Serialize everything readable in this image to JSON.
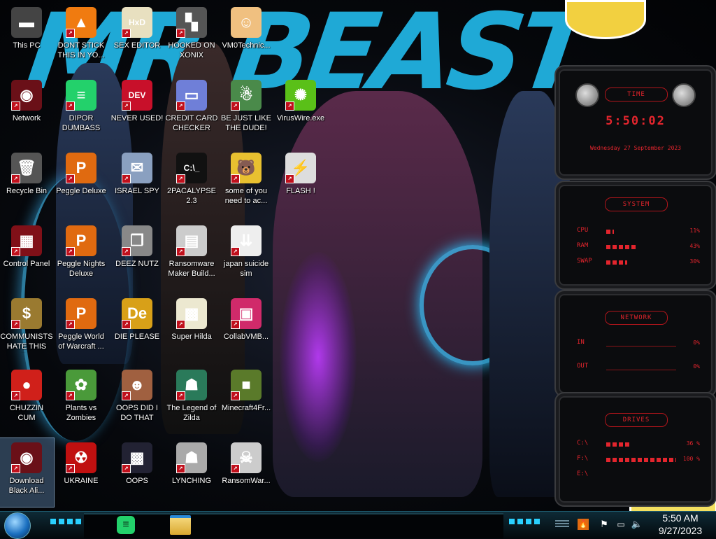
{
  "desktop": {
    "icons": [
      {
        "label": "This PC",
        "glyph": "▬",
        "color": "#444"
      },
      {
        "label": "DONT STICK THIS IN YO...",
        "glyph": "▲",
        "color": "#f07b10"
      },
      {
        "label": "SEX EDITOR",
        "glyph": "HxD",
        "color": "#e8e0c0"
      },
      {
        "label": "HOOKED ON XONIX",
        "glyph": "▚",
        "color": "#555"
      },
      {
        "label": "VM0Technic...",
        "glyph": "☺",
        "color": "#f0c080"
      },
      {
        "label": "Network",
        "glyph": "◉",
        "color": "#6a1018"
      },
      {
        "label": "DIPOR DUMBASS",
        "glyph": "≡",
        "color": "#23d16b"
      },
      {
        "label": "NEVER USED!",
        "glyph": "DEV",
        "color": "#c8102a"
      },
      {
        "label": "CREDIT CARD CHECKER",
        "glyph": "▭",
        "color": "#6f7fd8"
      },
      {
        "label": "BE JUST LIKE THE DUDE!",
        "glyph": "☃",
        "color": "#4a8a4a"
      },
      {
        "label": "VirusWire.exe",
        "glyph": "✺",
        "color": "#5ac018"
      },
      {
        "label": "Recycle Bin",
        "glyph": "🗑",
        "color": "#555"
      },
      {
        "label": "Peggle Deluxe",
        "glyph": "P",
        "color": "#e06a10"
      },
      {
        "label": "ISRAEL SPY",
        "glyph": "✉",
        "color": "#8aa0c0"
      },
      {
        "label": "2PACALYPSE 2.3",
        "glyph": "C:\\_",
        "color": "#111"
      },
      {
        "label": "some of you need to ac...",
        "glyph": "🐻",
        "color": "#e8c030"
      },
      {
        "label": "FLASH !",
        "glyph": "⚡",
        "color": "#ddd"
      },
      {
        "label": "Control Panel",
        "glyph": "▦",
        "color": "#801018"
      },
      {
        "label": "Peggle Nights Deluxe",
        "glyph": "P",
        "color": "#e06a10"
      },
      {
        "label": "DEEZ NUTZ",
        "glyph": "❐",
        "color": "#888"
      },
      {
        "label": "Ransomware Maker Build...",
        "glyph": "▤",
        "color": "#ccc"
      },
      {
        "label": "japan suicide sim",
        "glyph": "⇊",
        "color": "#eee"
      },
      {
        "label": "COMMUNISTS HATE THIS G...",
        "glyph": "$",
        "color": "#9a7a30"
      },
      {
        "label": "Peggle World of Warcraft ...",
        "glyph": "P",
        "color": "#e06a10"
      },
      {
        "label": "DIE PLEASE",
        "glyph": "De",
        "color": "#d8a018"
      },
      {
        "label": "Super Hilda",
        "glyph": "▩",
        "color": "#ece8d0"
      },
      {
        "label": "CollabVMB...",
        "glyph": "▣",
        "color": "#d02a6a"
      },
      {
        "label": "CHUZZIN CUM",
        "glyph": "●",
        "color": "#d0201a"
      },
      {
        "label": "Plants vs Zombies",
        "glyph": "✿",
        "color": "#4a9a3a"
      },
      {
        "label": "OOPS DID I DO THAT",
        "glyph": "☻",
        "color": "#a06040"
      },
      {
        "label": "The Legend of Zilda",
        "glyph": "☗",
        "color": "#2a7a5a"
      },
      {
        "label": "Minecraft4Fr...",
        "glyph": "■",
        "color": "#5a7a2a"
      },
      {
        "label": "Download Black Ali...",
        "glyph": "◉",
        "color": "#6a1018"
      },
      {
        "label": "UKRAINE",
        "glyph": "☢",
        "color": "#c01010"
      },
      {
        "label": "OOPS",
        "glyph": "▩",
        "color": "#223"
      },
      {
        "label": "LYNCHING",
        "glyph": "☗",
        "color": "#aaa"
      },
      {
        "label": "RansomWar...",
        "glyph": "☠",
        "color": "#ccc"
      }
    ]
  },
  "wallpaper": {
    "title_text": "MR BEAST"
  },
  "gadgets": {
    "time": {
      "title": "TIME",
      "clock": "5:50:02",
      "date": "Wednesday 27 September 2023"
    },
    "system": {
      "title": "SYSTEM",
      "rows": [
        {
          "label": "CPU",
          "value": "11%",
          "level": 0.11
        },
        {
          "label": "RAM",
          "value": "43%",
          "level": 0.43
        },
        {
          "label": "SWAP",
          "value": "30%",
          "level": 0.3
        }
      ]
    },
    "network": {
      "title": "NETWORK",
      "rows": [
        {
          "label": "IN",
          "value": "0%"
        },
        {
          "label": "OUT",
          "value": "0%"
        }
      ]
    },
    "drives": {
      "title": "DRIVES",
      "rows": [
        {
          "label": "C:\\",
          "value": "36 %",
          "level": 0.36
        },
        {
          "label": "F:\\",
          "value": "100 %",
          "level": 1.0
        },
        {
          "label": "E:\\",
          "value": "",
          "level": 0.0
        }
      ]
    }
  },
  "taskbar": {
    "clock_time": "5:50 AM",
    "clock_date": "9/27/2023",
    "pinned": [
      "Spotify",
      "File Explorer"
    ]
  }
}
